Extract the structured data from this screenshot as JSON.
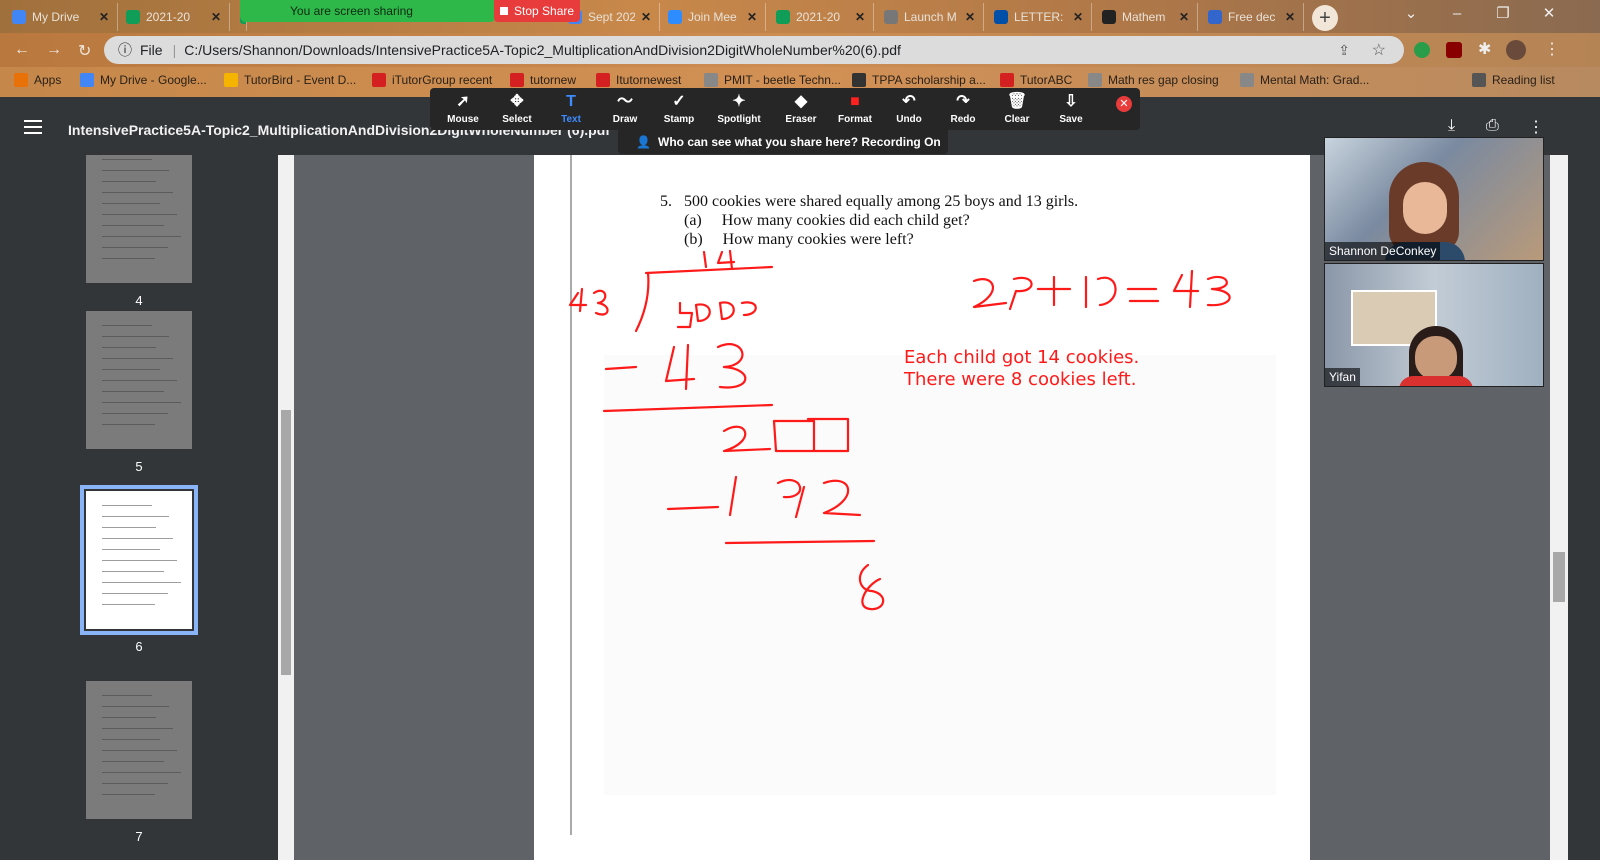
{
  "tabs": [
    {
      "title": "My Drive",
      "favicon": "google-drive-icon",
      "color": "#4285f4"
    },
    {
      "title": "2021-20",
      "favicon": "google-sheets-icon",
      "color": "#0f9d58"
    },
    {
      "title": "",
      "favicon": "google-sheets-icon",
      "color": "#0f9d58"
    },
    {
      "title": "Sept 202",
      "favicon": "calendar-icon",
      "color": "#4285f4"
    },
    {
      "title": "Join Mee",
      "favicon": "zoom-icon",
      "color": "#2d8cff"
    },
    {
      "title": "2021-20",
      "favicon": "google-sheets-icon",
      "color": "#0f9d58"
    },
    {
      "title": "Launch M",
      "favicon": "globe-icon",
      "color": "#777"
    },
    {
      "title": "LETTER:",
      "favicon": "lidl-icon",
      "color": "#0050aa"
    },
    {
      "title": "Mathem",
      "favicon": "shield-icon",
      "color": "#222"
    },
    {
      "title": "Free dec",
      "favicon": "math-icon",
      "color": "#3366cc"
    }
  ],
  "screen_share": {
    "status": "You are screen sharing",
    "stop_label": "Stop Share"
  },
  "address_bar": {
    "scheme_label": "File",
    "url": "C:/Users/Shannon/Downloads/IntensivePractice5A-Topic2_MultiplicationAndDivision2DigitWholeNumber%20(6).pdf"
  },
  "bookmarks": [
    {
      "label": "Apps",
      "icon": "apps-grid-icon",
      "color": "#e8710a"
    },
    {
      "label": "My Drive - Google...",
      "icon": "google-drive-icon",
      "color": "#4285f4"
    },
    {
      "label": "TutorBird - Event D...",
      "icon": "tutorbird-icon",
      "color": "#f4b400"
    },
    {
      "label": "iTutorGroup recent",
      "icon": "itutor-icon",
      "color": "#d42020"
    },
    {
      "label": "tutornew",
      "icon": "itutor-icon",
      "color": "#d42020"
    },
    {
      "label": "Itutornewest",
      "icon": "itutor-icon",
      "color": "#d42020"
    },
    {
      "label": "PMIT - beetle Techn...",
      "icon": "globe-icon",
      "color": "#888"
    },
    {
      "label": "TPPA scholarship a...",
      "icon": "tppa-icon",
      "color": "#333"
    },
    {
      "label": "TutorABC",
      "icon": "itutor-icon",
      "color": "#d42020"
    },
    {
      "label": "Math res gap closing",
      "icon": "globe-icon",
      "color": "#888"
    },
    {
      "label": "Mental Math: Grad...",
      "icon": "globe-icon",
      "color": "#888"
    },
    {
      "label": "Reading list",
      "icon": "reading-list-icon",
      "color": "#555"
    }
  ],
  "pdf": {
    "title": "IntensivePractice5A-Topic2_MultiplicationAndDivision2DigitWholeNumber (6).pdf"
  },
  "annotation_tools": [
    {
      "label": "Mouse",
      "icon": "cursor-icon",
      "glyph": "➚"
    },
    {
      "label": "Select",
      "icon": "move-icon",
      "glyph": "✥"
    },
    {
      "label": "Text",
      "icon": "text-icon",
      "glyph": "T"
    },
    {
      "label": "Draw",
      "icon": "draw-icon",
      "glyph": "〜"
    },
    {
      "label": "Stamp",
      "icon": "stamp-icon",
      "glyph": "✓"
    },
    {
      "label": "Spotlight",
      "icon": "spotlight-icon",
      "glyph": "✦"
    },
    {
      "label": "Eraser",
      "icon": "eraser-icon",
      "glyph": "◆"
    },
    {
      "label": "Format",
      "icon": "format-icon",
      "glyph": "■"
    },
    {
      "label": "Undo",
      "icon": "undo-icon",
      "glyph": "↶"
    },
    {
      "label": "Redo",
      "icon": "redo-icon",
      "glyph": "↷"
    },
    {
      "label": "Clear",
      "icon": "trash-icon",
      "glyph": "🗑"
    },
    {
      "label": "Save",
      "icon": "save-icon",
      "glyph": "⇩"
    }
  ],
  "share_notice": "Who can see what you share here? Recording On",
  "thumbnails": [
    {
      "page": "4",
      "selected": false
    },
    {
      "page": "5",
      "selected": false
    },
    {
      "page": "6",
      "selected": true
    },
    {
      "page": "7",
      "selected": false
    }
  ],
  "question": {
    "number": "5.",
    "text": "500 cookies were shared equally among 25 boys and 13 girls.",
    "parts": [
      {
        "label": "(a)",
        "text": "How many cookies did each child get?"
      },
      {
        "label": "(b)",
        "text": "How many cookies were left?"
      }
    ]
  },
  "answer": {
    "line1": "Each child got 14 cookies.",
    "line2": "There were 8 cookies left.",
    "color": "#ff1a1a"
  },
  "participants": [
    {
      "name": "Shannon DeConkey"
    },
    {
      "name": "Yifan"
    }
  ],
  "colors": {
    "accent": "#8ab4f8",
    "ink": "#ff1a1a",
    "share_green": "#2fb84a",
    "stop_red": "#e83b3b"
  }
}
